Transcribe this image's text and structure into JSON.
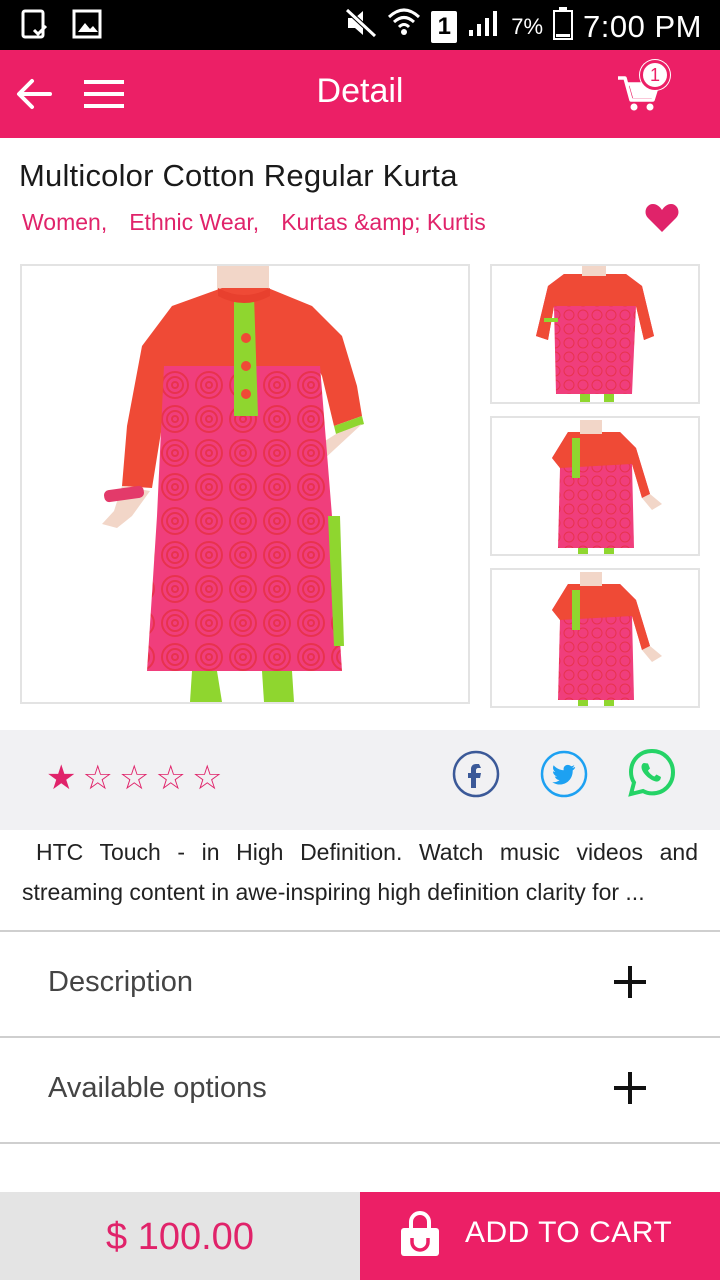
{
  "status_bar": {
    "sim_slot": "1",
    "battery_percent": "7%",
    "time": "7:00 PM"
  },
  "app_bar": {
    "title": "Detail",
    "cart_count": "1"
  },
  "product": {
    "title": "Multicolor Cotton Regular Kurta",
    "categories": [
      "Women,",
      "Ethnic Wear,",
      "Kurtas &amp; Kurtis"
    ],
    "rating": {
      "filled": 1,
      "total": 5,
      "filled_glyph": "★",
      "empty_glyph": "☆"
    },
    "summary": "HTC Touch - in High Definition. Watch music videos and streaming content in awe-inspiring high definition clarity for ..."
  },
  "accordion": {
    "description_label": "Description",
    "options_label": "Available options"
  },
  "bottom_bar": {
    "price": "$ 100.00",
    "add_to_cart_label": "ADD TO CART"
  },
  "colors": {
    "brand": "#ec1f66",
    "accent_text": "#e0236a",
    "facebook": "#3b5998",
    "twitter": "#1da1f2",
    "whatsapp": "#25d366"
  }
}
